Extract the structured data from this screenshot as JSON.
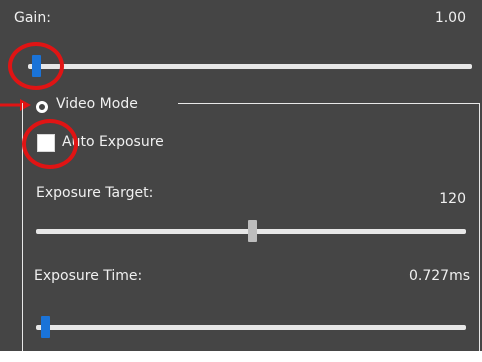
{
  "gain": {
    "label": "Gain:",
    "value_text": "1.00",
    "level": 0.03
  },
  "video_mode": {
    "label": "Video Mode"
  },
  "auto_exposure": {
    "label": "Auto Exposure",
    "checked": false
  },
  "exposure_target": {
    "label": "Exposure Target:",
    "value_text": "120",
    "level": 0.5
  },
  "exposure_time": {
    "label": "Exposure Time:",
    "value_text": "0.727ms",
    "level": 0.03
  },
  "colors": {
    "background": "#454545",
    "accent_blue": "#1a73d8",
    "annotation_red": "#e01414"
  }
}
